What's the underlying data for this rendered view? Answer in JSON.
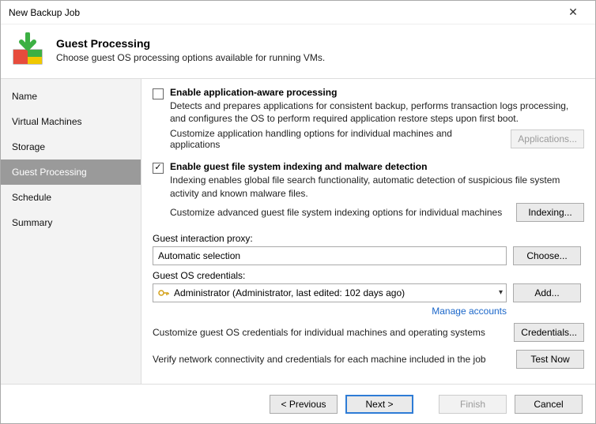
{
  "window": {
    "title": "New Backup Job"
  },
  "header": {
    "title": "Guest Processing",
    "subtitle": "Choose guest OS processing options available for running VMs."
  },
  "sidebar": {
    "items": [
      {
        "label": "Name"
      },
      {
        "label": "Virtual Machines"
      },
      {
        "label": "Storage"
      },
      {
        "label": "Guest Processing"
      },
      {
        "label": "Schedule"
      },
      {
        "label": "Summary"
      }
    ]
  },
  "appAware": {
    "title": "Enable application-aware processing",
    "desc": "Detects and prepares applications for consistent backup, performs transaction logs processing, and configures the OS to perform required application restore steps upon first boot.",
    "customize": "Customize application handling options for individual machines and applications",
    "button": "Applications..."
  },
  "indexing": {
    "title": "Enable guest file system indexing and malware detection",
    "desc": "Indexing enables global file search functionality, automatic detection of suspicious file system activity and known malware files.",
    "customize": "Customize advanced guest file system indexing options for individual machines",
    "button": "Indexing..."
  },
  "proxy": {
    "label": "Guest interaction proxy:",
    "value": "Automatic selection",
    "choose": "Choose..."
  },
  "creds": {
    "label": "Guest OS credentials:",
    "value": "Administrator (Administrator, last edited: 102 days ago)",
    "add": "Add...",
    "manage": "Manage accounts",
    "customize": "Customize guest OS credentials for individual machines and operating systems",
    "credsBtn": "Credentials...",
    "verify": "Verify network connectivity and credentials for each machine included in the job",
    "testBtn": "Test Now"
  },
  "footer": {
    "previous": "< Previous",
    "next": "Next >",
    "finish": "Finish",
    "cancel": "Cancel"
  }
}
